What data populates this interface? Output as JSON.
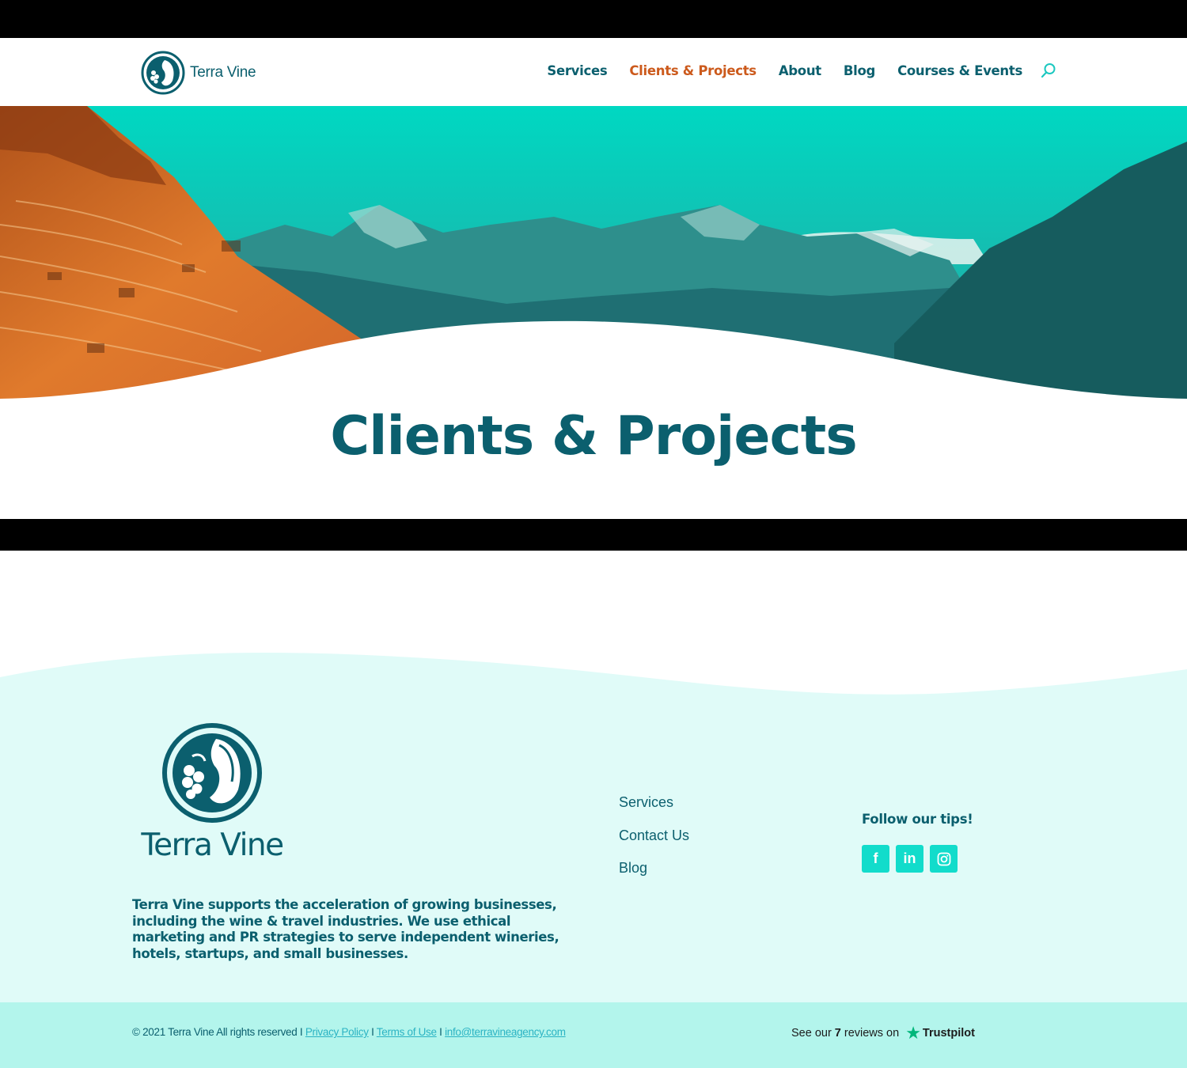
{
  "brand": {
    "name": "Terra Vine",
    "colors": {
      "teal_dark": "#0b5f6e",
      "accent_orange": "#cc5a1c",
      "aqua": "#12dccb",
      "mint_bg": "#e0fbf8",
      "mint_bar": "#b3f5ec"
    }
  },
  "nav": {
    "items": [
      {
        "label": "Services",
        "active": false
      },
      {
        "label": "Clients & Projects",
        "active": true
      },
      {
        "label": "About",
        "active": false
      },
      {
        "label": "Blog",
        "active": false
      },
      {
        "label": "Courses & Events",
        "active": false
      }
    ],
    "search_icon": "search-icon"
  },
  "hero": {
    "title": "Clients & Projects"
  },
  "footer": {
    "logo_text": "Terra Vine",
    "about": "Terra Vine supports the acceleration of growing businesses, including the wine & travel industries. We use ethical marketing and PR strategies to serve independent wineries, hotels, startups, and small businesses.",
    "links": [
      "Services",
      "Contact Us",
      "Blog"
    ],
    "follow_heading": "Follow our tips!",
    "social": [
      {
        "icon": "facebook-icon",
        "glyph": "f"
      },
      {
        "icon": "linkedin-icon",
        "glyph": "in"
      },
      {
        "icon": "instagram-icon",
        "glyph": ""
      }
    ],
    "copyright": "© 2021 Terra Vine All rights reserved I",
    "privacy": "Privacy Policy",
    "sep": "I",
    "terms": "Terms of Use",
    "email": "info@terravineagency.com",
    "trustpilot": {
      "prefix": "See our",
      "count": "7",
      "suffix": "reviews on",
      "brand": "Trustpilot"
    }
  }
}
